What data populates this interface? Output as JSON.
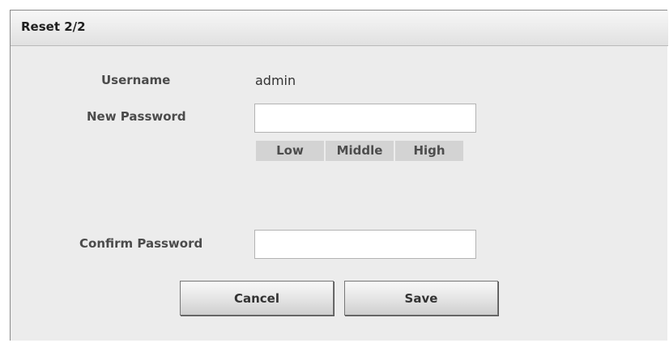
{
  "dialog": {
    "title": "Reset 2/2"
  },
  "form": {
    "username_label": "Username",
    "username_value": "admin",
    "new_password_label": "New Password",
    "new_password_value": "",
    "confirm_password_label": "Confirm Password",
    "confirm_password_value": "",
    "strength_levels": [
      "Low",
      "Middle",
      "High"
    ]
  },
  "buttons": {
    "cancel_label": "Cancel",
    "save_label": "Save"
  }
}
